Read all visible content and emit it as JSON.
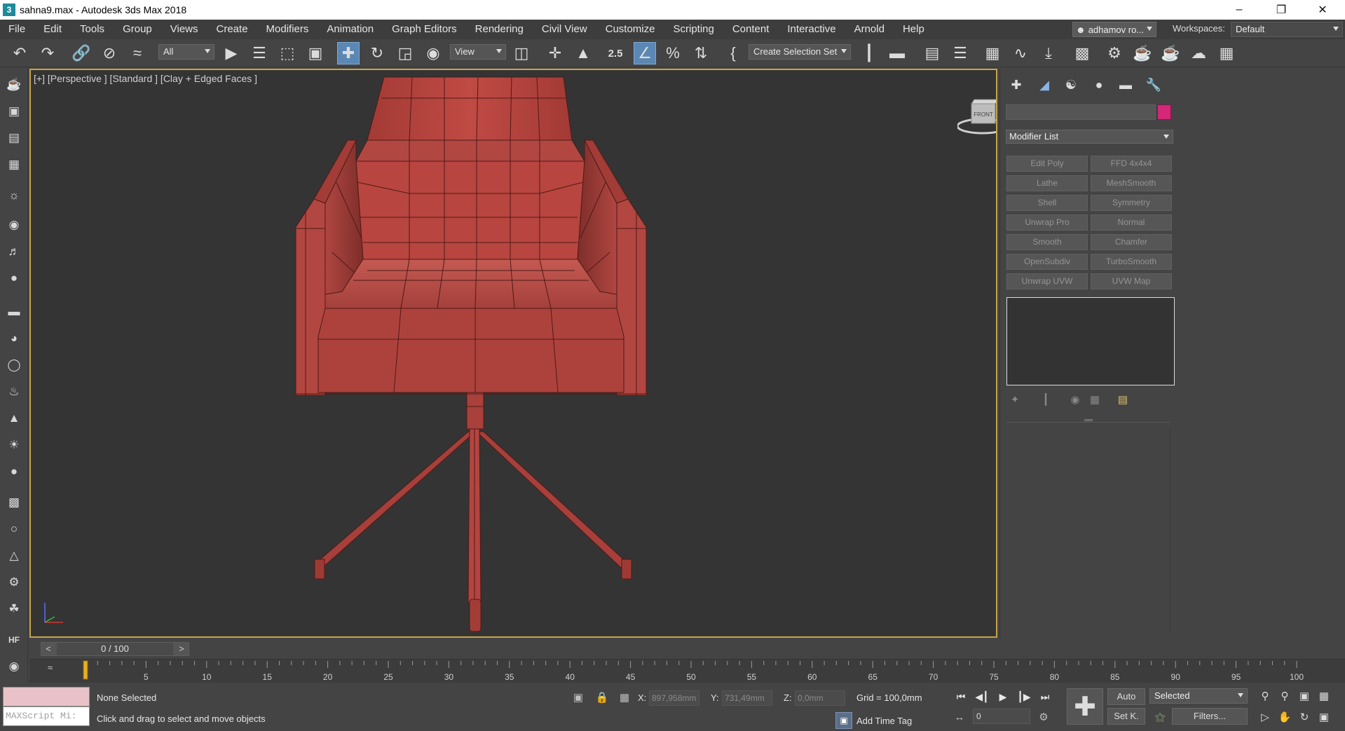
{
  "window": {
    "title": "sahna9.max - Autodesk 3ds Max 2018",
    "app_icon": "3",
    "minimize": "–",
    "restore": "❐",
    "close": "✕"
  },
  "menu": [
    "File",
    "Edit",
    "Tools",
    "Group",
    "Views",
    "Create",
    "Modifiers",
    "Animation",
    "Graph Editors",
    "Rendering",
    "Civil View",
    "Customize",
    "Scripting",
    "Content",
    "Interactive",
    "Arnold",
    "Help"
  ],
  "account": {
    "user": "adhamov ro...",
    "workspaces_label": "Workspaces:",
    "workspace": "Default"
  },
  "toolbar": {
    "filter": "All",
    "ref_coord": "View",
    "selection_set": "Create Selection Set",
    "snap_label": "2.5",
    "icons": [
      "undo-icon",
      "redo-icon",
      "link-icon",
      "unlink-icon",
      "bind-space-warp-icon",
      "select-object-icon",
      "select-by-name-icon",
      "rect-selection-icon",
      "window-crossing-icon",
      "select-move-icon",
      "select-rotate-icon",
      "select-scale-icon",
      "placement-icon",
      "select-manipulate-icon",
      "pivot-icon",
      "keyboard-shortcut-icon",
      "snaps-toggle-icon",
      "angle-snap-icon",
      "percent-snap-icon",
      "spinner-snap-icon",
      "named-selection-icon",
      "mirror-icon",
      "align-icon",
      "scene-explorer-icon",
      "layer-explorer-icon",
      "ribbon-icon",
      "curve-editor-icon",
      "schematic-view-icon",
      "material-editor-icon",
      "render-setup-icon",
      "rendered-frame-icon",
      "render-icon",
      "render-cloud-icon",
      "a360-icon",
      "render-iterative-icon"
    ]
  },
  "left_tools": [
    "teapot-icon",
    "render-icon",
    "sheet-icon",
    "table-icon",
    "light-bulb-icon",
    "camera-icon",
    "sound-icon",
    "video-icon",
    "plane-icon",
    "sphere-half-icon",
    "sphere-icon",
    "teapot-alt-icon",
    "cone-icon",
    "sun-icon",
    "globe-icon",
    "hatch-icon",
    "joint-icon",
    "helper-icon",
    "gear-globe-icon",
    "plant-icon",
    "hf-icon",
    "snail-icon"
  ],
  "viewport": {
    "label": "[+] [Perspective ] [Standard ] [Clay + Edged Faces ]",
    "viewcube_label": "FRONT",
    "colors": {
      "bg": "#343434",
      "border": "#c6a349",
      "model": "#b8443f",
      "edge": "#5a1e1b"
    }
  },
  "command_panel": {
    "tabs": [
      "create-icon",
      "modify-icon",
      "hierarchy-icon",
      "motion-icon",
      "display-icon",
      "utilities-icon"
    ],
    "object_color": "#d42777",
    "modifier_list": "Modifier List",
    "modifier_buttons": [
      [
        "Edit Poly",
        "FFD 4x4x4"
      ],
      [
        "Lathe",
        "MeshSmooth"
      ],
      [
        "Shell",
        "Symmetry"
      ],
      [
        "Unwrap Pro",
        "Normal"
      ],
      [
        "Smooth",
        "Chamfer"
      ],
      [
        "OpenSubdiv",
        "TurboSmooth"
      ],
      [
        "Unwrap UVW",
        "UVW Map"
      ]
    ],
    "stack_tools": [
      "pin-stack-icon",
      "show-end-result-icon",
      "make-unique-icon",
      "remove-modifier-icon",
      "configure-modifier-sets-icon"
    ]
  },
  "time": {
    "slider": "0 / 100",
    "prev": "<",
    "next": ">",
    "ticks": [
      "5",
      "10",
      "15",
      "20",
      "25",
      "30",
      "35",
      "40",
      "45",
      "50",
      "55",
      "60",
      "65",
      "70",
      "75",
      "80",
      "85",
      "90",
      "95",
      "100"
    ],
    "curve_icon": "≈"
  },
  "status": {
    "maxscript_placeholder": "MAXScript Mi:",
    "selection": "None Selected",
    "prompt": "Click and drag to select and move objects",
    "x_label": "X:",
    "x_value": "897,958mm",
    "y_label": "Y:",
    "y_value": "731,49mm",
    "z_label": "Z:",
    "z_value": "0,0mm",
    "grid": "Grid = 100,0mm",
    "add_time_tag": "Add Time Tag",
    "frame": "0",
    "auto": "Auto",
    "set_key": "Set K.",
    "selected": "Selected",
    "filters": "Filters..."
  }
}
